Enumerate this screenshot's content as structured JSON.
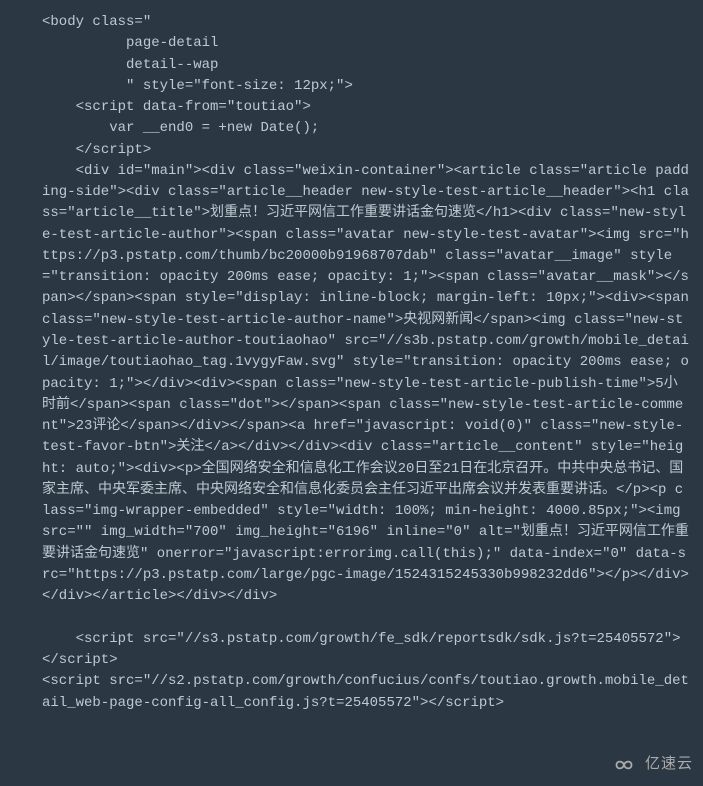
{
  "code": {
    "snippet": "<body class=\"\n          page-detail\n          detail--wap\n          \" style=\"font-size: 12px;\">\n    <script data-from=\"toutiao\">\n        var __end0 = +new Date();\n    </script>\n    <div id=\"main\"><div class=\"weixin-container\"><article class=\"article padding-side\"><div class=\"article__header new-style-test-article__header\"><h1 class=\"article__title\">划重点！习近平网信工作重要讲话金句速览</h1><div class=\"new-style-test-article-author\"><span class=\"avatar new-style-test-avatar\"><img src=\"https://p3.pstatp.com/thumb/bc20000b91968707dab\" class=\"avatar__image\" style=\"transition: opacity 200ms ease; opacity: 1;\"><span class=\"avatar__mask\"></span></span><span style=\"display: inline-block; margin-left: 10px;\"><div><span class=\"new-style-test-article-author-name\">央视网新闻</span><img class=\"new-style-test-article-author-toutiaohao\" src=\"//s3b.pstatp.com/growth/mobile_detail/image/toutiaohao_tag.1vygyFaw.svg\" style=\"transition: opacity 200ms ease; opacity: 1;\"></div><div><span class=\"new-style-test-article-publish-time\">5小时前</span><span class=\"dot\"></span><span class=\"new-style-test-article-comment\">23评论</span></div></span><a href=\"javascript: void(0)\" class=\"new-style-test-favor-btn\">关注</a></div></div><div class=\"article__content\" style=\"height: auto;\"><div><p>全国网络安全和信息化工作会议20日至21日在北京召开。中共中央总书记、国家主席、中央军委主席、中央网络安全和信息化委员会主任习近平出席会议并发表重要讲话。</p><p class=\"img-wrapper-embedded\" style=\"width: 100%; min-height: 4000.85px;\"><img src=\"\" img_width=\"700\" img_height=\"6196\" inline=\"0\" alt=\"划重点！习近平网信工作重要讲话金句速览\" onerror=\"javascript:errorimg.call(this);\" data-index=\"0\" data-src=\"https://p3.pstatp.com/large/pgc-image/1524315245330b998232dd6\"></p></div></div></article></div></div>\n\n    <script src=\"//s3.pstatp.com/growth/fe_sdk/reportsdk/sdk.js?t=25405572\"></script>\n<script src=\"//s2.pstatp.com/growth/confucius/confs/toutiao.growth.mobile_detail_web-page-config-all_config.js?t=25405572\"></script>"
  },
  "watermark": {
    "text": "亿速云"
  }
}
